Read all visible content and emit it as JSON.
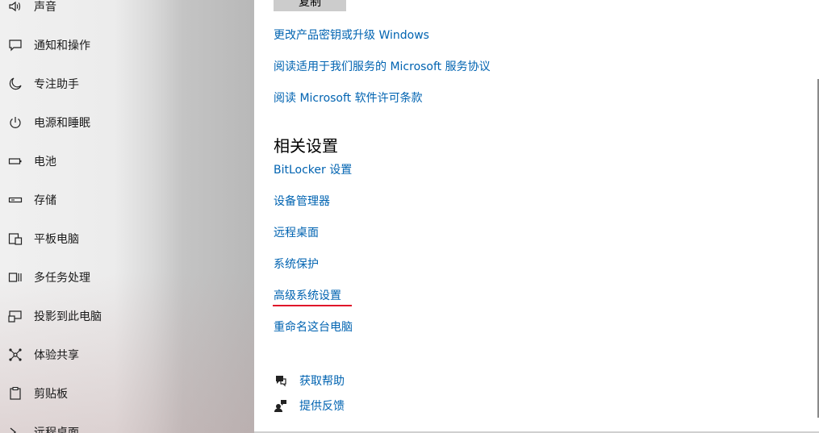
{
  "sidebar": {
    "items": [
      {
        "label": "声音",
        "icon": "speaker-icon"
      },
      {
        "label": "通知和操作",
        "icon": "notification-icon"
      },
      {
        "label": "专注助手",
        "icon": "moon-icon"
      },
      {
        "label": "电源和睡眠",
        "icon": "power-icon"
      },
      {
        "label": "电池",
        "icon": "battery-icon"
      },
      {
        "label": "存储",
        "icon": "storage-icon"
      },
      {
        "label": "平板电脑",
        "icon": "tablet-icon"
      },
      {
        "label": "多任务处理",
        "icon": "multitasking-icon"
      },
      {
        "label": "投影到此电脑",
        "icon": "projection-icon"
      },
      {
        "label": "体验共享",
        "icon": "share-icon"
      },
      {
        "label": "剪贴板",
        "icon": "clipboard-icon"
      },
      {
        "label": "远程桌面",
        "icon": "remote-desktop-icon"
      }
    ]
  },
  "main": {
    "copy_button": "复制",
    "top_links": [
      "更改产品密钥或升级 Windows",
      "阅读适用于我们服务的 Microsoft 服务协议",
      "阅读 Microsoft 软件许可条款"
    ],
    "related_title": "相关设置",
    "related_links": [
      "BitLocker 设置",
      "设备管理器",
      "远程桌面",
      "系统保护",
      "高级系统设置",
      "重命名这台电脑"
    ],
    "help": {
      "get_help": "获取帮助",
      "feedback": "提供反馈"
    },
    "highlight_color": "#e0142a",
    "link_color": "#0063b1"
  }
}
